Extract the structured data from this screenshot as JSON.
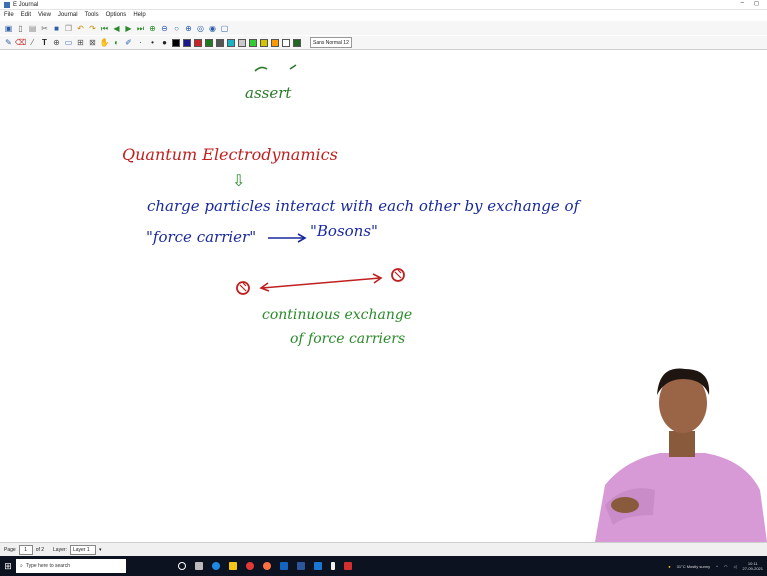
{
  "window": {
    "title": "E Journal",
    "controls": [
      "–",
      "◻"
    ]
  },
  "menu": [
    "File",
    "Edit",
    "View",
    "Journal",
    "Tools",
    "Options",
    "Help"
  ],
  "toolbar2": {
    "colors": [
      "#000000",
      "#1a1a8c",
      "#cc2222",
      "#1f7a1f",
      "#555555",
      "#19b3c6",
      "#c8c8c8",
      "#33cc33",
      "#d4c400",
      "#ff9900",
      "#ffffff",
      "#226622"
    ],
    "font_label": "Sans Normal",
    "font_size": "12"
  },
  "canvas": {
    "top_fragment": "assert",
    "heading": "Quantum Electrodynamics",
    "arrow_down": "⇩",
    "line1": "charge particles interact with each other by exchange of",
    "line2a": "\"force carrier\"",
    "line2b": "→",
    "line2c": "\"Bosons\"",
    "exchange1": "continuous exchange",
    "exchange2": "of force carriers"
  },
  "status": {
    "page_label": "Page",
    "page_value": "1",
    "of_label": "of 2",
    "layer_label": "Layer:",
    "layer_value": "Layer 1"
  },
  "taskbar": {
    "search_placeholder": "Type here to search",
    "weather": "31°C Mostly sunny",
    "time": "10:11",
    "date": "27-09-2021"
  }
}
